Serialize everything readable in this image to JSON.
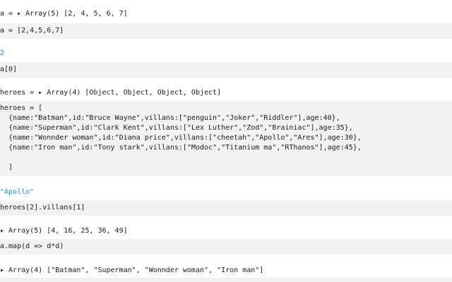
{
  "cells": [
    {
      "type": "output",
      "text": "a = ▸ Array(5) [2, 4, 5, 6, 7]"
    },
    {
      "type": "input",
      "text": "a = [2,4,5,6,7]"
    },
    {
      "type": "output",
      "text": "2"
    },
    {
      "type": "input",
      "text": "a[0]"
    },
    {
      "type": "output",
      "text": "heroes = ▸ Array(4) [Object, Object, Object, Object]"
    },
    {
      "type": "input_multiline",
      "lines": [
        "heroes = [",
        "  {name:\"Batman\",id:\"Bruce Wayne\",villans:[\"penguin\",\"Joker\",\"Riddler\"],age:40},",
        "  {name:\"Superman\",id:\"Clark Kent\",villans:[\"Lex Luther\",\"Zod\",\"Brainiac\"],age:35},",
        "  {name:\"Wonnder woman\",id:\"Diana price\",villans:[\"cheetah\",\"Apollo\",\"Ares\"],age:30},",
        "  {name:\"Iron man\",id:\"Tony stark\",villans:[\"Modoc\",\"Titanium ma\",\"RThanos\"],age:45},",
        "",
        "  ]"
      ]
    },
    {
      "type": "output",
      "text": "\"Apollo\""
    },
    {
      "type": "input",
      "text": "heroes[2].villans[1]"
    },
    {
      "type": "output",
      "text": "▸ Array(5) [4, 16, 25, 36, 49]"
    },
    {
      "type": "input",
      "text": "a.map(d => d*d)"
    },
    {
      "type": "output",
      "text": "▸ Array(4) [\"Batman\", \"Superman\", \"Wonnder woman\", \"Iron man\"]"
    }
  ]
}
